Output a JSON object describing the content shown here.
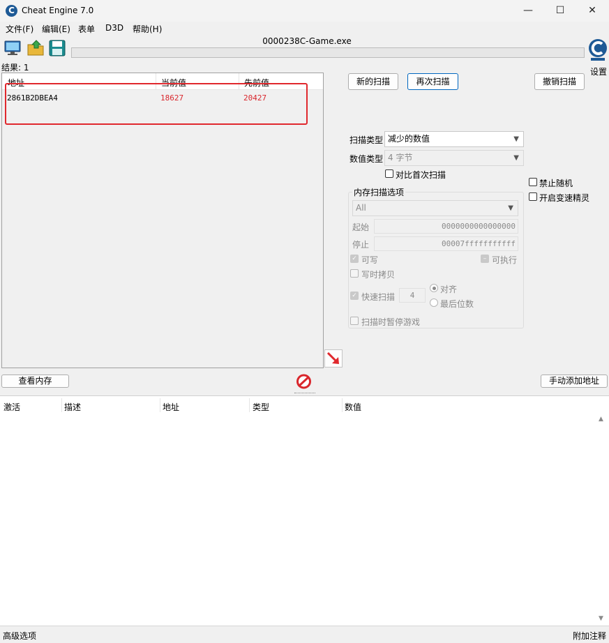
{
  "window": {
    "title": "Cheat Engine 7.0",
    "minimize": "—",
    "maximize": "☐",
    "close": "✕"
  },
  "menu": [
    "文件(F)",
    "编辑(E)",
    "表单",
    "D3D",
    "帮助(H)"
  ],
  "toolbar": {
    "process_title": "0000238C-Game.exe",
    "settings_label": "设置",
    "icons": [
      "open-process-icon",
      "open-file-icon",
      "save-icon"
    ]
  },
  "results": {
    "count_label": "结果: 1",
    "columns": [
      "地址",
      "当前值",
      "先前值"
    ],
    "rows": [
      {
        "address": "2861B2DBEA4",
        "current": "18627",
        "previous": "20427"
      }
    ],
    "value_color": "#d9262c",
    "highlight_color": "#e0282d"
  },
  "scan": {
    "new_scan": "新的扫描",
    "next_scan": "再次扫描",
    "undo_scan": "撤销扫描",
    "scan_type_label": "扫描类型",
    "scan_type_value": "减少的数值",
    "value_type_label": "数值类型",
    "value_type_value": "4 字节",
    "compare_first": "对比首次扫描",
    "memory_options": {
      "group_label": "内存扫描选项",
      "region": "All",
      "start_label": "起始",
      "start_value": "0000000000000000",
      "stop_label": "停止",
      "stop_value": "00007fffffffffff",
      "writable": "可写",
      "executable": "可执行",
      "copy_on_write": "写时拷贝",
      "fast_scan": "快速扫描",
      "fast_scan_value": "4",
      "align": "对齐",
      "last_digits": "最后位数",
      "pause_game": "扫描时暂停游戏"
    },
    "disable_random": "禁止随机",
    "speedhack": "开启变速精灵"
  },
  "bottom": {
    "view_memory": "查看内存",
    "add_address": "手动添加地址",
    "columns": [
      "激活",
      "描述",
      "地址",
      "类型",
      "数值"
    ],
    "advanced": "高级选项",
    "add_comment": "附加注释"
  }
}
